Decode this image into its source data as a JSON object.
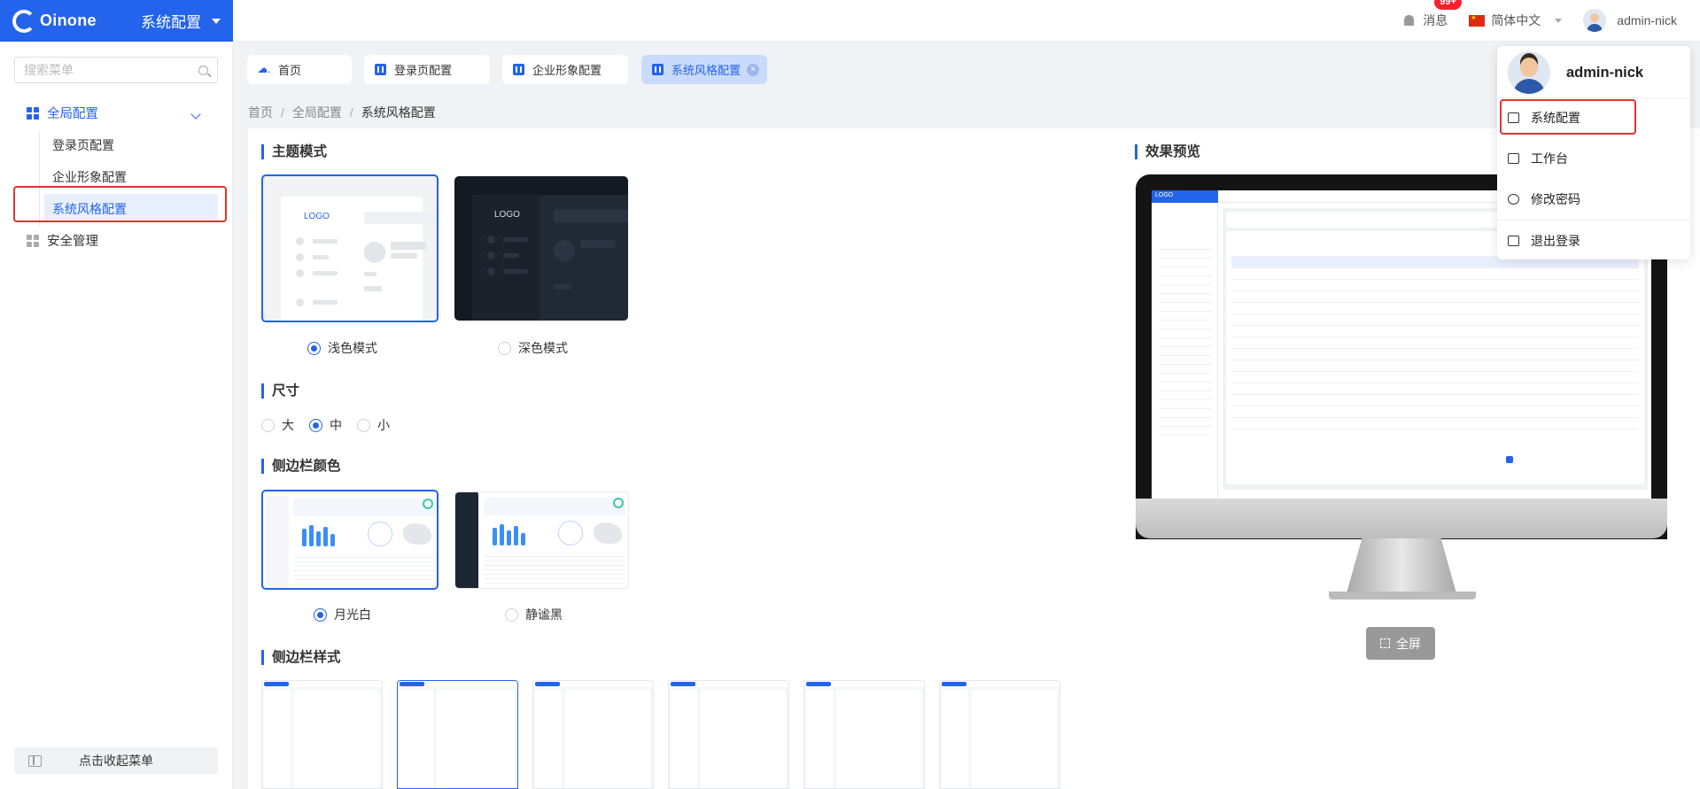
{
  "app": {
    "logo_text": "Oinone",
    "app_name": "系统配置"
  },
  "topbar": {
    "messages_label": "消息",
    "messages_badge": "99+",
    "language": "简体中文",
    "username": "admin-nick"
  },
  "sidebar": {
    "search_placeholder": "搜索菜单",
    "groups": [
      {
        "label": "全局配置",
        "expanded": true,
        "children": [
          "登录页配置",
          "企业形象配置",
          "系统风格配置"
        ],
        "active_child": "系统风格配置"
      },
      {
        "label": "安全管理"
      }
    ],
    "collapse_label": "点击收起菜单"
  },
  "tabs": [
    {
      "label": "首页"
    },
    {
      "label": "登录页配置"
    },
    {
      "label": "企业形象配置"
    },
    {
      "label": "系统风格配置",
      "active": true
    }
  ],
  "breadcrumb": [
    "首页",
    "全局配置",
    "系统风格配置"
  ],
  "theme_mode": {
    "title": "主题模式",
    "card_logo": "LOGO",
    "options": [
      "浅色模式",
      "深色模式"
    ],
    "selected": "浅色模式"
  },
  "size": {
    "title": "尺寸",
    "options": [
      "大",
      "中",
      "小"
    ],
    "selected": "中"
  },
  "sidebar_color": {
    "title": "侧边栏颜色",
    "options": [
      "月光白",
      "静谧黑"
    ],
    "selected": "月光白"
  },
  "sidebar_style": {
    "title": "侧边栏样式",
    "count": 6,
    "selected_index": 1
  },
  "preview": {
    "title": "效果预览",
    "fullscreen_label": "全屏",
    "screen_logo": "LOGO"
  },
  "user_dropdown": {
    "username": "admin-nick",
    "items": [
      "系统配置",
      "工作台",
      "修改密码",
      "退出登录"
    ]
  },
  "colors": {
    "primary": "#2463eb",
    "highlight_border": "#e5322e",
    "dark_card": "#141a22"
  }
}
